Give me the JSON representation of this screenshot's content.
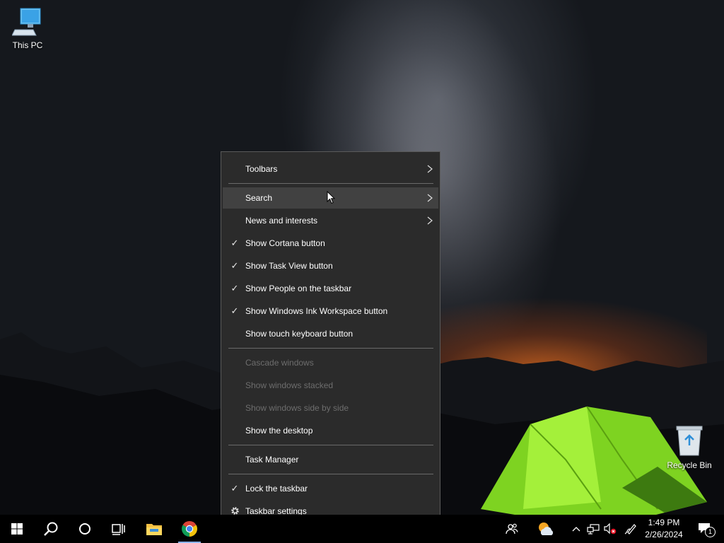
{
  "desktop": {
    "icons": [
      {
        "label": "This PC",
        "icon": "this-pc-icon"
      },
      {
        "label": "Recycle Bin",
        "icon": "recycle-bin-icon"
      }
    ]
  },
  "context_menu": {
    "items": [
      {
        "label": "Toolbars",
        "submenu": true,
        "checked": false,
        "enabled": true
      },
      {
        "label": "Search",
        "submenu": true,
        "checked": false,
        "enabled": true,
        "hovered": true
      },
      {
        "label": "News and interests",
        "submenu": true,
        "checked": false,
        "enabled": true
      },
      {
        "label": "Show Cortana button",
        "checked": true,
        "enabled": true
      },
      {
        "label": "Show Task View button",
        "checked": true,
        "enabled": true
      },
      {
        "label": "Show People on the taskbar",
        "checked": true,
        "enabled": true
      },
      {
        "label": "Show Windows Ink Workspace button",
        "checked": true,
        "enabled": true
      },
      {
        "label": "Show touch keyboard button",
        "checked": false,
        "enabled": true
      },
      {
        "label": "Cascade windows",
        "enabled": false
      },
      {
        "label": "Show windows stacked",
        "enabled": false
      },
      {
        "label": "Show windows side by side",
        "enabled": false
      },
      {
        "label": "Show the desktop",
        "enabled": true
      },
      {
        "label": "Task Manager",
        "enabled": true
      },
      {
        "label": "Lock the taskbar",
        "checked": true,
        "enabled": true
      },
      {
        "label": "Taskbar settings",
        "icon": "gear-icon",
        "enabled": true
      }
    ]
  },
  "taskbar": {
    "buttons": [
      "start-icon",
      "search-icon",
      "cortana-icon",
      "task-view-icon",
      "file-explorer-icon",
      "chrome-icon"
    ],
    "tray": {
      "icons": [
        "people-icon",
        "weather-icon",
        "chevron-up-icon",
        "network-icon",
        "volume-muted-icon",
        "ink-workspace-icon",
        "notifications-icon"
      ],
      "time": "1:49 PM",
      "date": "2/26/2024",
      "notification_count": "1"
    }
  },
  "colors": {
    "menu_bg": "#2b2b2b",
    "menu_hover": "#414141",
    "menu_disabled_text": "#6d6d6d",
    "taskbar_bg": "#000000",
    "chrome_running_indicator": "#8ab4f8"
  }
}
